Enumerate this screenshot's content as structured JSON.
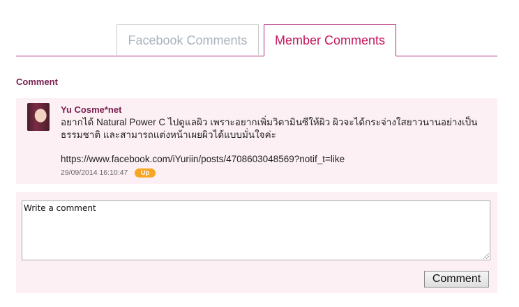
{
  "tabs": [
    {
      "label": "Facebook Comments",
      "active": false
    },
    {
      "label": "Member Comments",
      "active": true
    }
  ],
  "section": {
    "title": "Comment"
  },
  "comments": [
    {
      "author": "Yu Cosme*net",
      "text": "อยากได้ Natural Power C ไปดูแลผิว เพราะอยากเพิ่มวิตามินซีให้ผิว ผิวจะได้กระจ่างใสยาวนานอย่างเป็นธรรมชาติ และสามารถแต่งหน้าเผยผิวได้แบบมั่นใจค่ะ",
      "link": "https://www.facebook.com/iYuriin/posts/4708603048569?notif_t=like",
      "date": "29/09/2014 16:10:47",
      "badge": "Up",
      "avatar_icon": "user-avatar-photo"
    }
  ],
  "form": {
    "textarea_value": "Write a comment",
    "submit_label": "Comment"
  },
  "colors": {
    "accent": "#b0277a",
    "active_tab_text": "#c2185b",
    "inactive_tab_text": "#a9b3bd",
    "panel_bg": "#fdf0f4",
    "badge_bg": "#f5a623"
  }
}
